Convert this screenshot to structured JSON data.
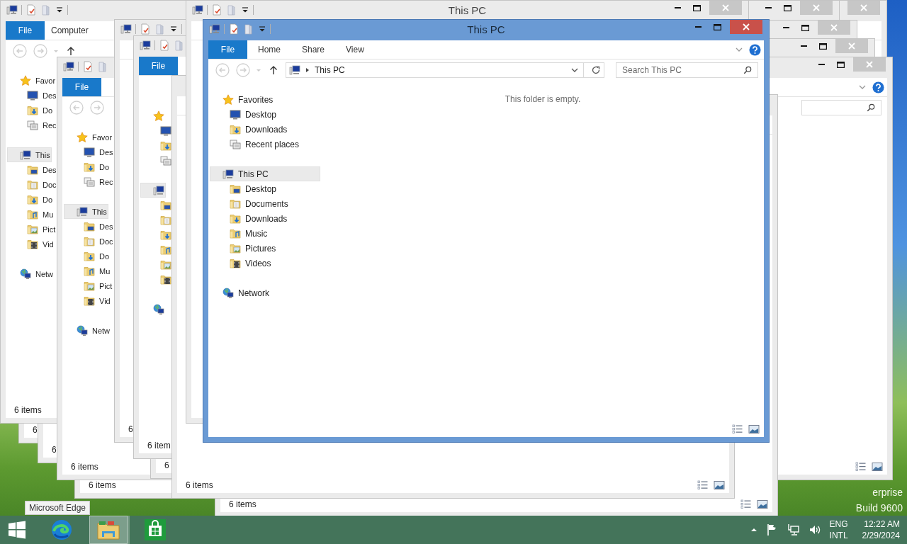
{
  "windows": [
    {
      "active": false
    },
    {
      "active": false
    },
    {
      "active": false
    },
    {
      "active": false
    },
    {
      "active": false
    },
    {
      "status": "6 items"
    },
    {
      "status": "6"
    },
    {
      "status": "6"
    },
    {
      "status": "6 items"
    },
    {
      "ribbon": [
        {
          "kind": "file",
          "label": "File"
        },
        {
          "kind": "tab",
          "label": "Computer",
          "selected": false
        }
      ],
      "nav": [
        {
          "kind": "star",
          "label": "Favor",
          "selected": false,
          "children": [
            {
              "kind": "desktop",
              "label": "Des",
              "selected": false
            },
            {
              "kind": "downloads",
              "label": "Do",
              "selected": false
            },
            {
              "kind": "recent",
              "label": "Rec",
              "selected": false
            }
          ]
        },
        {
          "kind": "pc",
          "label": "This",
          "selected": true,
          "children": [
            {
              "kind": "desktop-folder",
              "label": "Des",
              "selected": false
            },
            {
              "kind": "documents",
              "label": "Doc",
              "selected": false
            },
            {
              "kind": "downloads",
              "label": "Do",
              "selected": false
            },
            {
              "kind": "music",
              "label": "Mu",
              "selected": false
            },
            {
              "kind": "pictures",
              "label": "Pict",
              "selected": false
            },
            {
              "kind": "videos",
              "label": "Vid",
              "selected": false
            }
          ]
        },
        {
          "kind": "network",
          "label": "Netw",
          "selected": false
        }
      ],
      "status": "6 items"
    },
    {
      "ribbon": [
        {
          "kind": "file",
          "label": "File"
        }
      ],
      "nav": [
        {
          "kind": "star",
          "label": "Favor",
          "selected": false,
          "children": [
            {
              "kind": "desktop",
              "label": "Des",
              "selected": false
            },
            {
              "kind": "downloads",
              "label": "Do",
              "selected": false
            },
            {
              "kind": "recent",
              "label": "Rec",
              "selected": false
            }
          ]
        },
        {
          "kind": "pc",
          "label": "This",
          "selected": true,
          "children": [
            {
              "kind": "desktop-folder",
              "label": "Des",
              "selected": false
            },
            {
              "kind": "documents",
              "label": "Doc",
              "selected": false
            },
            {
              "kind": "downloads",
              "label": "Do",
              "selected": false
            },
            {
              "kind": "music",
              "label": "Mu",
              "selected": false
            },
            {
              "kind": "pictures",
              "label": "Pict",
              "selected": false
            },
            {
              "kind": "videos",
              "label": "Vid",
              "selected": false
            }
          ]
        },
        {
          "kind": "network",
          "label": "Netw",
          "selected": false
        }
      ],
      "status": "6 items"
    },
    {
      "status": "6"
    },
    {
      "status": "6"
    },
    {
      "ribbon": [
        {
          "kind": "file",
          "label": "File"
        }
      ],
      "nav": [
        {
          "kind": "star",
          "selected": false,
          "children": [
            {
              "kind": "desktop",
              "selected": false
            },
            {
              "kind": "downloads",
              "selected": false
            },
            {
              "kind": "recent",
              "selected": false
            }
          ]
        },
        {
          "kind": "pc",
          "selected": true,
          "children": [
            {
              "kind": "desktop-folder",
              "selected": false
            },
            {
              "kind": "documents",
              "selected": false
            },
            {
              "kind": "downloads",
              "selected": false
            },
            {
              "kind": "music",
              "selected": false
            },
            {
              "kind": "pictures",
              "selected": false
            },
            {
              "kind": "videos",
              "selected": false
            }
          ]
        },
        {
          "kind": "network",
          "selected": false
        }
      ],
      "status": "6 item"
    },
    {
      "status": "6 items"
    },
    {
      "active": false,
      "title": "This PC"
    },
    {
      "active": true,
      "title": "This PC",
      "ribbon": [
        {
          "kind": "file",
          "label": "File"
        },
        {
          "kind": "tab",
          "label": "Home",
          "selected": false
        },
        {
          "kind": "tab",
          "label": "Share",
          "selected": false
        },
        {
          "kind": "tab",
          "label": "View",
          "selected": false
        }
      ],
      "address": "This PC",
      "search": {
        "placeholder": "Search This PC"
      },
      "nav": [
        {
          "kind": "star",
          "label": "Favorites",
          "selected": false,
          "children": [
            {
              "kind": "desktop",
              "label": "Desktop",
              "selected": false
            },
            {
              "kind": "downloads",
              "label": "Downloads",
              "selected": false
            },
            {
              "kind": "recent",
              "label": "Recent places",
              "selected": false
            }
          ]
        },
        {
          "kind": "pc",
          "label": "This PC",
          "selected": true,
          "children": [
            {
              "kind": "desktop-folder",
              "label": "Desktop",
              "selected": false
            },
            {
              "kind": "documents",
              "label": "Documents",
              "selected": false
            },
            {
              "kind": "downloads",
              "label": "Downloads",
              "selected": false
            },
            {
              "kind": "music",
              "label": "Music",
              "selected": false
            },
            {
              "kind": "pictures",
              "label": "Pictures",
              "selected": false
            },
            {
              "kind": "videos",
              "label": "Videos",
              "selected": false
            }
          ]
        },
        {
          "kind": "network",
          "label": "Network",
          "selected": false
        }
      ],
      "empty_message": "This folder is empty."
    }
  ],
  "desktop_edition_text": [
    "erprise",
    "Build 9600"
  ],
  "tooltip": "Microsoft Edge",
  "taskbar": {
    "apps": [
      {
        "kind": "edge",
        "selected": false
      },
      {
        "kind": "explorer",
        "selected": true
      },
      {
        "kind": "store",
        "selected": false
      }
    ],
    "tray": {
      "language": "ENG",
      "layout": "INTL",
      "time": "12:22 AM",
      "date": "2/29/2024"
    }
  }
}
